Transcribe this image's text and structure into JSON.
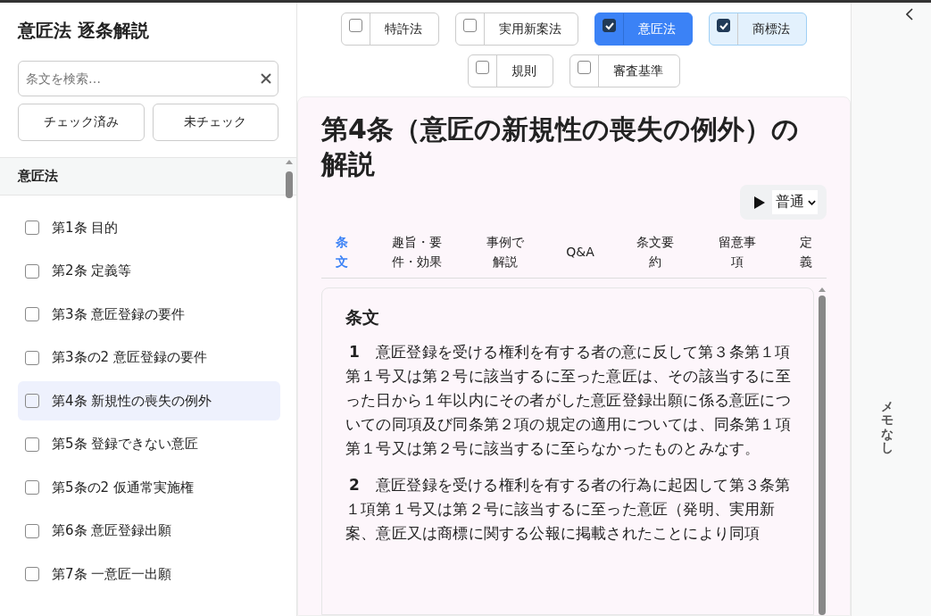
{
  "sidebar": {
    "title": "意匠法 逐条解説",
    "search": {
      "placeholder": "条文を検索…"
    },
    "filter_buttons": [
      "チェック済み",
      "未チェック"
    ],
    "section_title": "意匠法",
    "items": [
      {
        "label": "第1条 目的",
        "checked": false,
        "selected": false
      },
      {
        "label": "第2条 定義等",
        "checked": false,
        "selected": false
      },
      {
        "label": "第3条 意匠登録の要件",
        "checked": false,
        "selected": false
      },
      {
        "label": "第3条の2 意匠登録の要件",
        "checked": false,
        "selected": false
      },
      {
        "label": "第4条 新規性の喪失の例外",
        "checked": false,
        "selected": true
      },
      {
        "label": "第5条 登録できない意匠",
        "checked": false,
        "selected": false
      },
      {
        "label": "第5条の2 仮通常実施権",
        "checked": false,
        "selected": false
      },
      {
        "label": "第6条 意匠登録出願",
        "checked": false,
        "selected": false
      },
      {
        "label": "第7条 一意匠一出願",
        "checked": false,
        "selected": false
      }
    ]
  },
  "law_filters": [
    {
      "label": "特許法",
      "checked": false,
      "selected": false
    },
    {
      "label": "実用新案法",
      "checked": false,
      "selected": false
    },
    {
      "label": "意匠法",
      "checked": true,
      "selected": true
    },
    {
      "label": "商標法",
      "checked": true,
      "selected": false
    },
    {
      "label": "規則",
      "checked": false,
      "selected": false
    },
    {
      "label": "審査基準",
      "checked": false,
      "selected": false
    }
  ],
  "article": {
    "title": "第4条（意匠の新規性の喪失の例外）の解説",
    "speed": "普通",
    "tabs": [
      {
        "label": "条文",
        "selected": true
      },
      {
        "label": "趣旨・要件・効果",
        "selected": false
      },
      {
        "label": "事例で解説",
        "selected": false
      },
      {
        "label": "Q&A",
        "selected": false
      },
      {
        "label": "条文要約",
        "selected": false
      },
      {
        "label": "留意事項",
        "selected": false
      },
      {
        "label": "定義",
        "selected": false
      }
    ],
    "section_heading": "条文",
    "paragraphs": [
      {
        "number": "1",
        "text": "意匠登録を受ける権利を有する者の意に反して第３条第１項第１号又は第２号に該当するに至った意匠は、その該当するに至った日から１年以内にその者がした意匠登録出願に係る意匠についての同項及び同条第２項の規定の適用については、同条第１項第１号又は第２号に該当するに至らなかったものとみなす。"
      },
      {
        "number": "2",
        "text": "意匠登録を受ける権利を有する者の行為に起因して第３条第１項第１号又は第２号に該当するに至った意匠（発明、実用新案、意匠又は商標に関する公報に掲載されたことにより同項"
      }
    ]
  },
  "memo_panel": {
    "text": "メモなし"
  }
}
